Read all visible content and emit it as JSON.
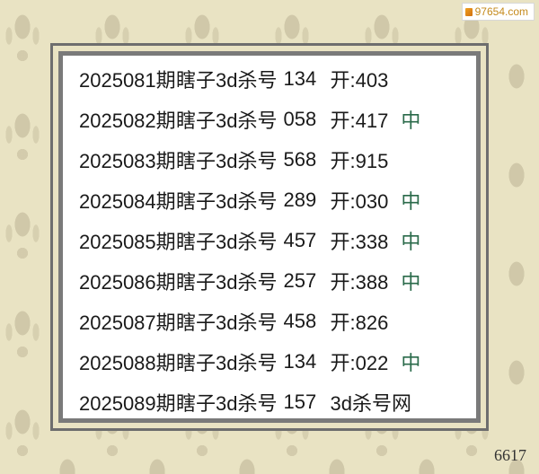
{
  "watermark": {
    "site": "97654.com"
  },
  "records": [
    {
      "issue": "2025081期",
      "text": "瞎子3d杀号",
      "kill": "134",
      "open": "开:403",
      "hit": ""
    },
    {
      "issue": "2025082期",
      "text": "瞎子3d杀号",
      "kill": "058",
      "open": "开:417",
      "hit": "中"
    },
    {
      "issue": "2025083期",
      "text": "瞎子3d杀号",
      "kill": "568",
      "open": "开:915",
      "hit": ""
    },
    {
      "issue": "2025084期",
      "text": "瞎子3d杀号",
      "kill": "289",
      "open": "开:030",
      "hit": "中"
    },
    {
      "issue": "2025085期",
      "text": "瞎子3d杀号",
      "kill": "457",
      "open": "开:338",
      "hit": "中"
    },
    {
      "issue": "2025086期",
      "text": "瞎子3d杀号",
      "kill": "257",
      "open": "开:388",
      "hit": "中"
    },
    {
      "issue": "2025087期",
      "text": "瞎子3d杀号",
      "kill": "458",
      "open": "开:826",
      "hit": ""
    },
    {
      "issue": "2025088期",
      "text": "瞎子3d杀号",
      "kill": "134",
      "open": "开:022",
      "hit": "中"
    },
    {
      "issue": "2025089期",
      "text": "瞎子3d杀号",
      "kill": "157",
      "open": "3d杀号网",
      "hit": ""
    }
  ],
  "footer": {
    "number": "6617"
  }
}
